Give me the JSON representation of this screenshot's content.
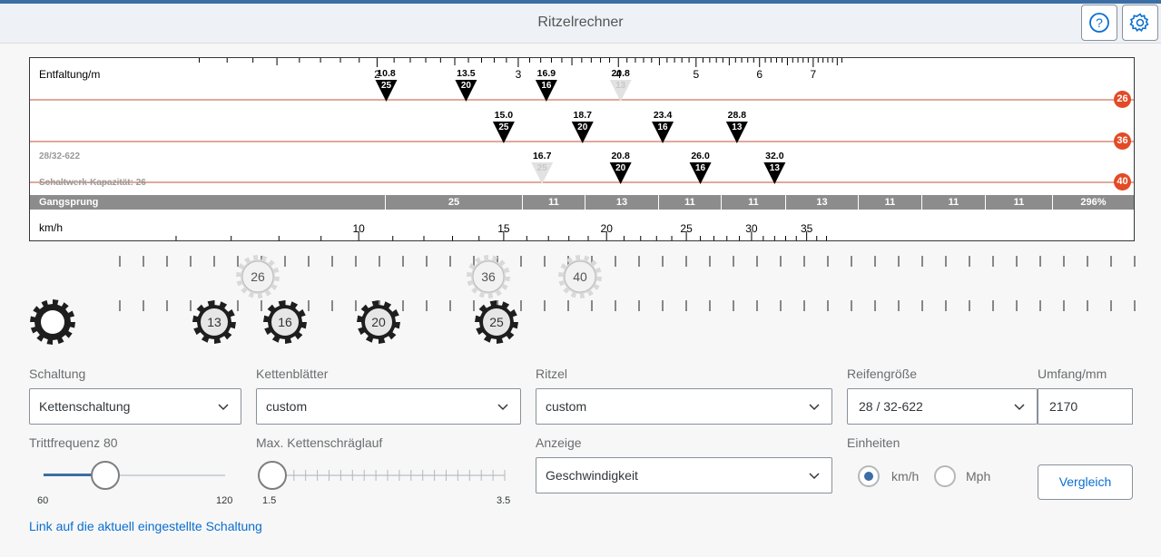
{
  "app": {
    "title": "Ritzelrechner"
  },
  "header": {
    "help_icon": "help-icon",
    "settings_icon": "gear-icon"
  },
  "chart_data": {
    "type": "table",
    "top_axis": {
      "label": "Entfaltung/m",
      "ticks": [
        "2",
        "3",
        "4",
        "5",
        "6",
        "7"
      ]
    },
    "rings": [
      {
        "teeth": "26",
        "color": "#e24b26",
        "marks": [
          {
            "value": "10.8",
            "cog": "25",
            "active": true
          },
          {
            "value": "13.5",
            "cog": "20",
            "active": true
          },
          {
            "value": "16.9",
            "cog": "16",
            "active": true
          },
          {
            "value": "20.8",
            "cog": "13",
            "active": false
          }
        ]
      },
      {
        "teeth": "36",
        "color": "#e24b26",
        "marks": [
          {
            "value": "15.0",
            "cog": "25",
            "active": true
          },
          {
            "value": "18.7",
            "cog": "20",
            "active": true
          },
          {
            "value": "23.4",
            "cog": "16",
            "active": true
          },
          {
            "value": "28.8",
            "cog": "13",
            "active": true
          }
        ]
      },
      {
        "teeth": "40",
        "color": "#e24b26",
        "marks": [
          {
            "value": "16.7",
            "cog": "25",
            "active": false
          },
          {
            "value": "20.8",
            "cog": "20",
            "active": true
          },
          {
            "value": "26.0",
            "cog": "16",
            "active": true
          },
          {
            "value": "32.0",
            "cog": "13",
            "active": true
          }
        ]
      }
    ],
    "info_tire": "28/32-622",
    "info_capacity": "Schaltwerk-Kapazität: 26",
    "gangsprung": {
      "label": "Gangsprung",
      "cells": [
        "25",
        "11",
        "13",
        "11",
        "11",
        "13",
        "11",
        "11",
        "11",
        "296%"
      ]
    },
    "bottom_axis": {
      "label": "km/h",
      "ticks": [
        "10",
        "15",
        "20",
        "25",
        "30",
        "35"
      ]
    }
  },
  "gears": {
    "chainrings": [
      "26",
      "36",
      "40"
    ],
    "cogs": [
      "13",
      "16",
      "20",
      "25"
    ]
  },
  "form": {
    "schaltung": {
      "label": "Schaltung",
      "value": "Kettenschaltung"
    },
    "kettenblaetter": {
      "label": "Kettenblätter",
      "value": "custom"
    },
    "ritzel": {
      "label": "Ritzel",
      "value": "custom"
    },
    "reifen": {
      "label": "Reifengröße",
      "value": "28 / 32-622"
    },
    "umfang": {
      "label": "Umfang/mm",
      "value": "2170"
    },
    "trittfrequenz": {
      "label": "Trittfrequenz 80",
      "min": "60",
      "max": "120",
      "value": 80
    },
    "schraeglauf": {
      "label": "Max. Kettenschräglauf",
      "min": "1.5",
      "max": "3.5",
      "value": 1.5
    },
    "anzeige": {
      "label": "Anzeige",
      "value": "Geschwindigkeit"
    },
    "einheiten": {
      "label": "Einheiten",
      "options": [
        "km/h",
        "Mph"
      ],
      "selected": "km/h"
    },
    "compare_button": "Vergleich",
    "link": "Link auf die aktuell eingestellte Schaltung"
  }
}
